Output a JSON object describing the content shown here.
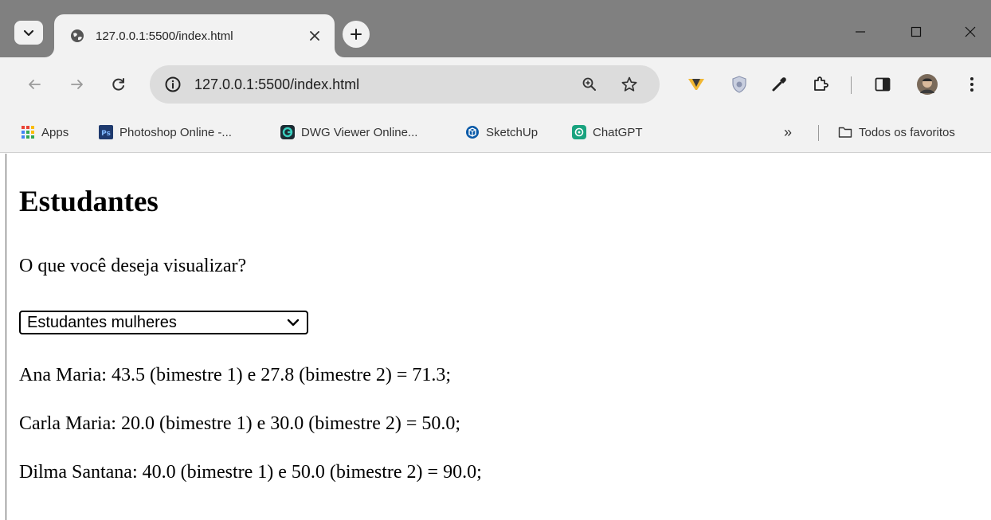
{
  "browser": {
    "tab": {
      "title": "127.0.0.1:5500/index.html"
    },
    "address_bar": {
      "url": "127.0.0.1:5500/index.html"
    },
    "bookmarks": [
      {
        "label": "Apps",
        "icon": "apps-grid-icon"
      },
      {
        "label": "Photoshop Online -...",
        "icon": "photoshop-icon"
      },
      {
        "label": "DWG Viewer Online...",
        "icon": "dwg-viewer-icon"
      },
      {
        "label": "SketchUp",
        "icon": "sketchup-icon"
      },
      {
        "label": "ChatGPT",
        "icon": "chatgpt-icon"
      }
    ],
    "bookmarks_overflow": "»",
    "all_bookmarks_label": "Todos os favoritos"
  },
  "page": {
    "title": "Estudantes",
    "question": "O que você deseja visualizar?",
    "select": {
      "value": "Estudantes mulheres"
    },
    "results": [
      "Ana Maria: 43.5 (bimestre 1) e 27.8 (bimestre 2) = 71.3;",
      "Carla Maria: 20.0 (bimestre 1) e 30.0 (bimestre 2) = 50.0;",
      "Dilma Santana: 40.0 (bimestre 1) e 50.0 (bimestre 2) = 90.0;"
    ]
  },
  "colors": {
    "tabstrip": "#808080",
    "toolbar": "#f2f2f2",
    "omnibox": "#dcdcdc",
    "page_bg": "#ffffff"
  }
}
